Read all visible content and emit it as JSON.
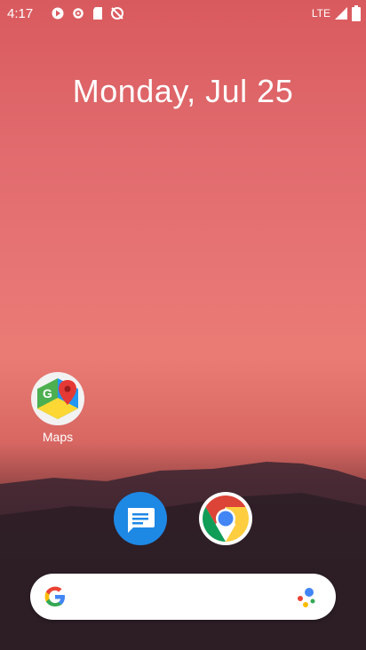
{
  "status_bar": {
    "time": "4:17",
    "network": "LTE",
    "icons": [
      "media-icon",
      "settings-icon",
      "sd-card-icon",
      "no-sync-icon",
      "signal-icon",
      "battery-icon"
    ]
  },
  "date": "Monday, Jul 25",
  "apps": {
    "maps": {
      "label": "Maps"
    },
    "messages": {
      "label": ""
    },
    "chrome": {
      "label": ""
    }
  },
  "search": {
    "placeholder": ""
  }
}
